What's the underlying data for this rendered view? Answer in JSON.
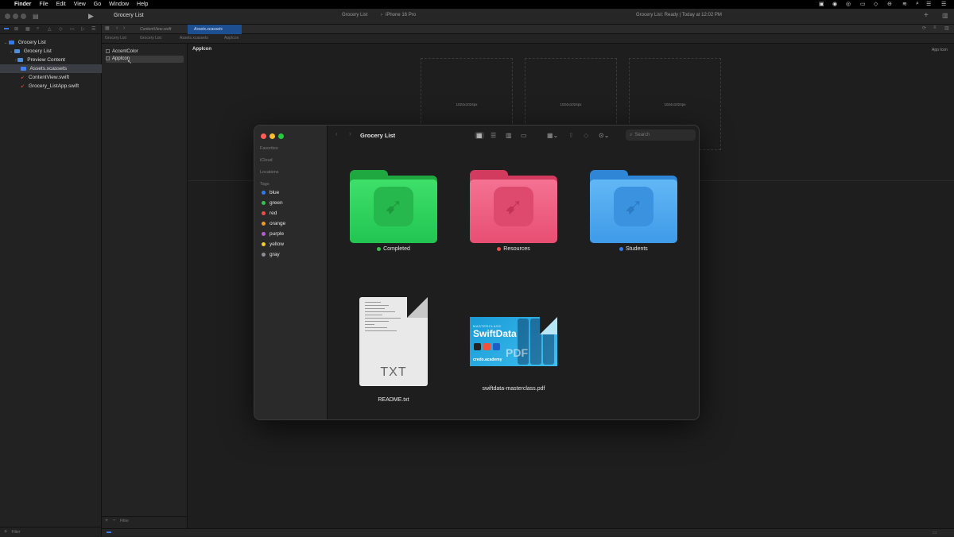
{
  "menubar": {
    "app": "Finder",
    "items": [
      "File",
      "Edit",
      "View",
      "Go",
      "Window",
      "Help"
    ]
  },
  "xcode": {
    "project_name": "Grocery List",
    "scheme": "Grocery List",
    "destination": "iPhone 16 Pro",
    "status": "Grocery List: Ready | Today at 12:02 PM",
    "tabs": [
      "ContentView.swift",
      "Assets.xcassets"
    ],
    "jumpbar": [
      "Grocery List",
      "Grocery List",
      "Assets.xcassets",
      "AppIcon"
    ],
    "navigator": {
      "items": [
        {
          "label": "Grocery List",
          "level": 0,
          "type": "project"
        },
        {
          "label": "Grocery List",
          "level": 1,
          "type": "group"
        },
        {
          "label": "Preview Content",
          "level": 2,
          "type": "group"
        },
        {
          "label": "Assets.xcassets",
          "level": 2,
          "type": "assets",
          "selected": true
        },
        {
          "label": "ContentView.swift",
          "level": 2,
          "type": "swift"
        },
        {
          "label": "Grocery_ListApp.swift",
          "level": 2,
          "type": "swift"
        }
      ],
      "filter_placeholder": "Filter"
    },
    "assets": {
      "items": [
        "AccentColor",
        "AppIcon"
      ],
      "selected": "AppIcon",
      "filter_placeholder": "Filter"
    },
    "editor": {
      "title": "AppIcon",
      "right_label": "App Icon",
      "slots": [
        "1024x1024px",
        "1024x1024px",
        "1024x1024px"
      ]
    }
  },
  "finder": {
    "title": "Grocery List",
    "search_placeholder": "Search",
    "sidebar": {
      "sections": [
        "Favorites",
        "iCloud",
        "Locations",
        "Tags"
      ],
      "tags": [
        {
          "name": "blue",
          "color": "#2f7bf5"
        },
        {
          "name": "green",
          "color": "#36c24a"
        },
        {
          "name": "red",
          "color": "#f04a4a"
        },
        {
          "name": "orange",
          "color": "#f59a23"
        },
        {
          "name": "purple",
          "color": "#b65cd6"
        },
        {
          "name": "yellow",
          "color": "#f5d023"
        },
        {
          "name": "gray",
          "color": "#8e8e93"
        }
      ]
    },
    "items": [
      {
        "name": "Completed",
        "kind": "folder",
        "tag_color": "#36c24a",
        "folder_color": "#2fd45a",
        "icon": "swift-bird-icon"
      },
      {
        "name": "Resources",
        "kind": "folder",
        "tag_color": "#f04a4a",
        "folder_color": "#ef5a7a",
        "icon": "swift-bird-icon"
      },
      {
        "name": "Students",
        "kind": "folder",
        "tag_color": "#2f7bf5",
        "folder_color": "#4aa6ee",
        "icon": "swift-bird-icon"
      },
      {
        "name": "README.txt",
        "kind": "text",
        "badge": "TXT"
      },
      {
        "name": "swiftdata-masterclass.pdf",
        "kind": "pdf"
      }
    ],
    "pdf_cover": {
      "kicker": "MASTERCLASS",
      "title": "SwiftData",
      "brand": "credo.academy",
      "badge": "PDF"
    }
  }
}
